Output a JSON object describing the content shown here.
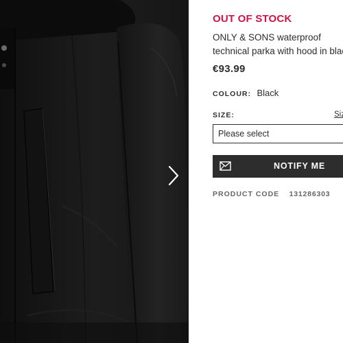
{
  "gallery": {
    "image_alt": "Black waterproof technical parka",
    "next_icon": "chevron-right-icon"
  },
  "product": {
    "stock_status": "OUT OF STOCK",
    "title_line1": "ONLY & SONS waterproof",
    "title_line2": "technical parka with hood in black",
    "price": "€93.99",
    "colour_label": "COLOUR:",
    "colour_value": "Black",
    "size_label": "SIZE:",
    "size_guide": "Size Guide",
    "size_placeholder": "Please select",
    "notify_label": "NOTIFY ME",
    "notify_icon": "mail-icon",
    "code_label": "PRODUCT CODE",
    "code_value": "131286303"
  },
  "colors": {
    "stock_red": "#d01345",
    "button_dark": "#2d2d2d",
    "text": "#2d2d2d",
    "muted": "#666666"
  }
}
